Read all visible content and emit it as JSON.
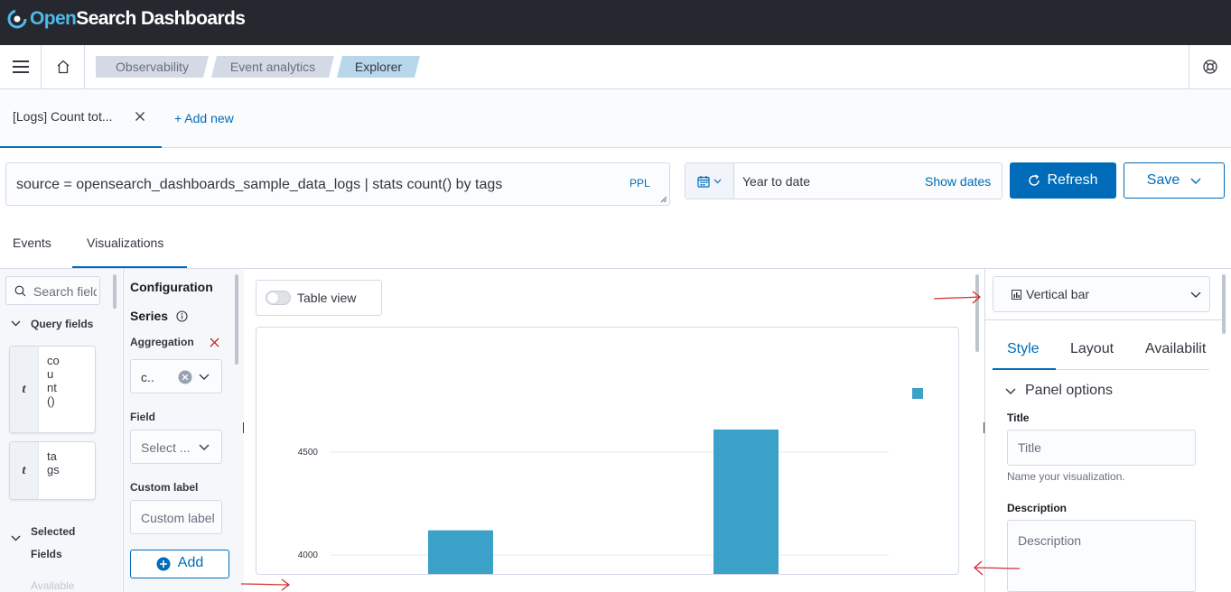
{
  "header": {
    "logo_open": "Open",
    "logo_rest": "Search Dashboards"
  },
  "nav": {
    "breadcrumbs": [
      "Observability",
      "Event analytics",
      "Explorer"
    ]
  },
  "query_tabs": {
    "active_tab": "[Logs] Count tot...",
    "add_new": "+ Add new"
  },
  "query": {
    "text": "source = opensearch_dashboards_sample_data_logs | stats count() by tags",
    "language": "PPL"
  },
  "date_picker": {
    "value": "Year to date",
    "show_dates": "Show dates"
  },
  "actions": {
    "refresh": "Refresh",
    "save": "Save"
  },
  "view_tabs": [
    "Events",
    "Visualizations"
  ],
  "sidebar": {
    "search_placeholder": "Search field names",
    "query_fields": "Query fields",
    "fields": [
      {
        "type": "t",
        "name": "count()"
      },
      {
        "type": "t",
        "name": "tags"
      }
    ],
    "selected_fields": "Selected Fields",
    "available": "Available"
  },
  "config": {
    "title": "Configuration",
    "series": "Series",
    "aggregation": "Aggregation",
    "aggregation_value": "c..",
    "field": "Field",
    "field_placeholder": "Select ...",
    "custom_label": "Custom label",
    "custom_label_placeholder": "Custom label",
    "add": "Add"
  },
  "main": {
    "table_view": "Table view"
  },
  "chart_data": {
    "type": "bar",
    "categories": [
      "",
      ""
    ],
    "values": [
      4120,
      4610
    ],
    "ytick_labels": [
      "4000",
      "4500"
    ],
    "bar_color": "#3ca1c9"
  },
  "right_panel": {
    "viz_type": "Vertical bar",
    "tabs": [
      "Style",
      "Layout",
      "Availabilit"
    ],
    "panel_options": "Panel options",
    "title_label": "Title",
    "title_placeholder": "Title",
    "title_help": "Name your visualization.",
    "description_label": "Description",
    "description_placeholder": "Description"
  },
  "colors": {
    "accent": "#006bb8",
    "topbar": "#25282f",
    "annotation": "#d32f2f"
  }
}
